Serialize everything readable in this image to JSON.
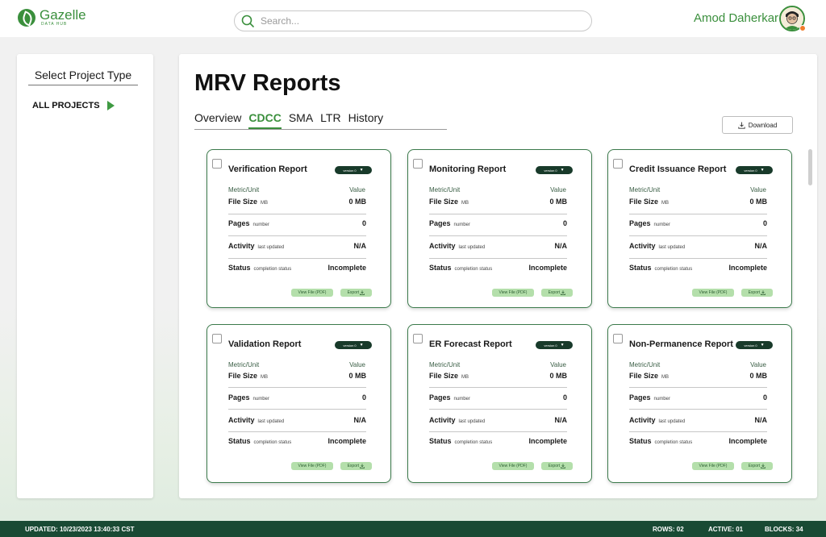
{
  "header": {
    "logo_name": "Gazelle",
    "logo_sub": "DATA HUB",
    "search_placeholder": "Search...",
    "user_name": "Amod Daherkar"
  },
  "sidebar": {
    "title": "Select Project Type",
    "items": [
      {
        "label": "ALL PROJECTS"
      }
    ]
  },
  "main": {
    "title": "MRV Reports",
    "tabs": [
      {
        "label": "Overview",
        "active": false
      },
      {
        "label": "CDCC",
        "active": true
      },
      {
        "label": "SMA",
        "active": false
      },
      {
        "label": "LTR",
        "active": false
      },
      {
        "label": "History",
        "active": false
      }
    ],
    "download_label": "Download"
  },
  "card_common": {
    "metric_header": "Metric/Unit",
    "value_header": "Value",
    "file_size_label": "File Size",
    "file_size_unit": "MB",
    "pages_label": "Pages",
    "pages_unit": "number",
    "activity_label": "Activity",
    "activity_unit": "last updated",
    "status_label": "Status",
    "status_unit": "completion status",
    "version_label": "version 0",
    "view_label": "View File (PDF)",
    "export_label": "Export"
  },
  "cards": [
    {
      "title": "Verification Report",
      "file_size": "0 MB",
      "pages": "0",
      "activity": "N/A",
      "status": "Incomplete"
    },
    {
      "title": "Monitoring Report",
      "file_size": "0 MB",
      "pages": "0",
      "activity": "N/A",
      "status": "Incomplete"
    },
    {
      "title": "Credit Issuance Report",
      "file_size": "0 MB",
      "pages": "0",
      "activity": "N/A",
      "status": "Incomplete"
    },
    {
      "title": "Validation Report",
      "file_size": "0 MB",
      "pages": "0",
      "activity": "N/A",
      "status": "Incomplete"
    },
    {
      "title": "ER Forecast Report",
      "file_size": "0 MB",
      "pages": "0",
      "activity": "N/A",
      "status": "Incomplete"
    },
    {
      "title": "Non-Permanence Report",
      "file_size": "0 MB",
      "pages": "0",
      "activity": "N/A",
      "status": "Incomplete"
    }
  ],
  "footer": {
    "updated": "UPDATED: 10/23/2023 13:40:33 CST",
    "rows": "ROWS: 02",
    "active": "ACTIVE: 01",
    "blocks": "BLOCKS: 34"
  },
  "colors": {
    "brand_green": "#3a8f3c",
    "footer_bg": "#194a34",
    "card_border": "#3b7a4b",
    "button_green": "#b4dfab"
  }
}
